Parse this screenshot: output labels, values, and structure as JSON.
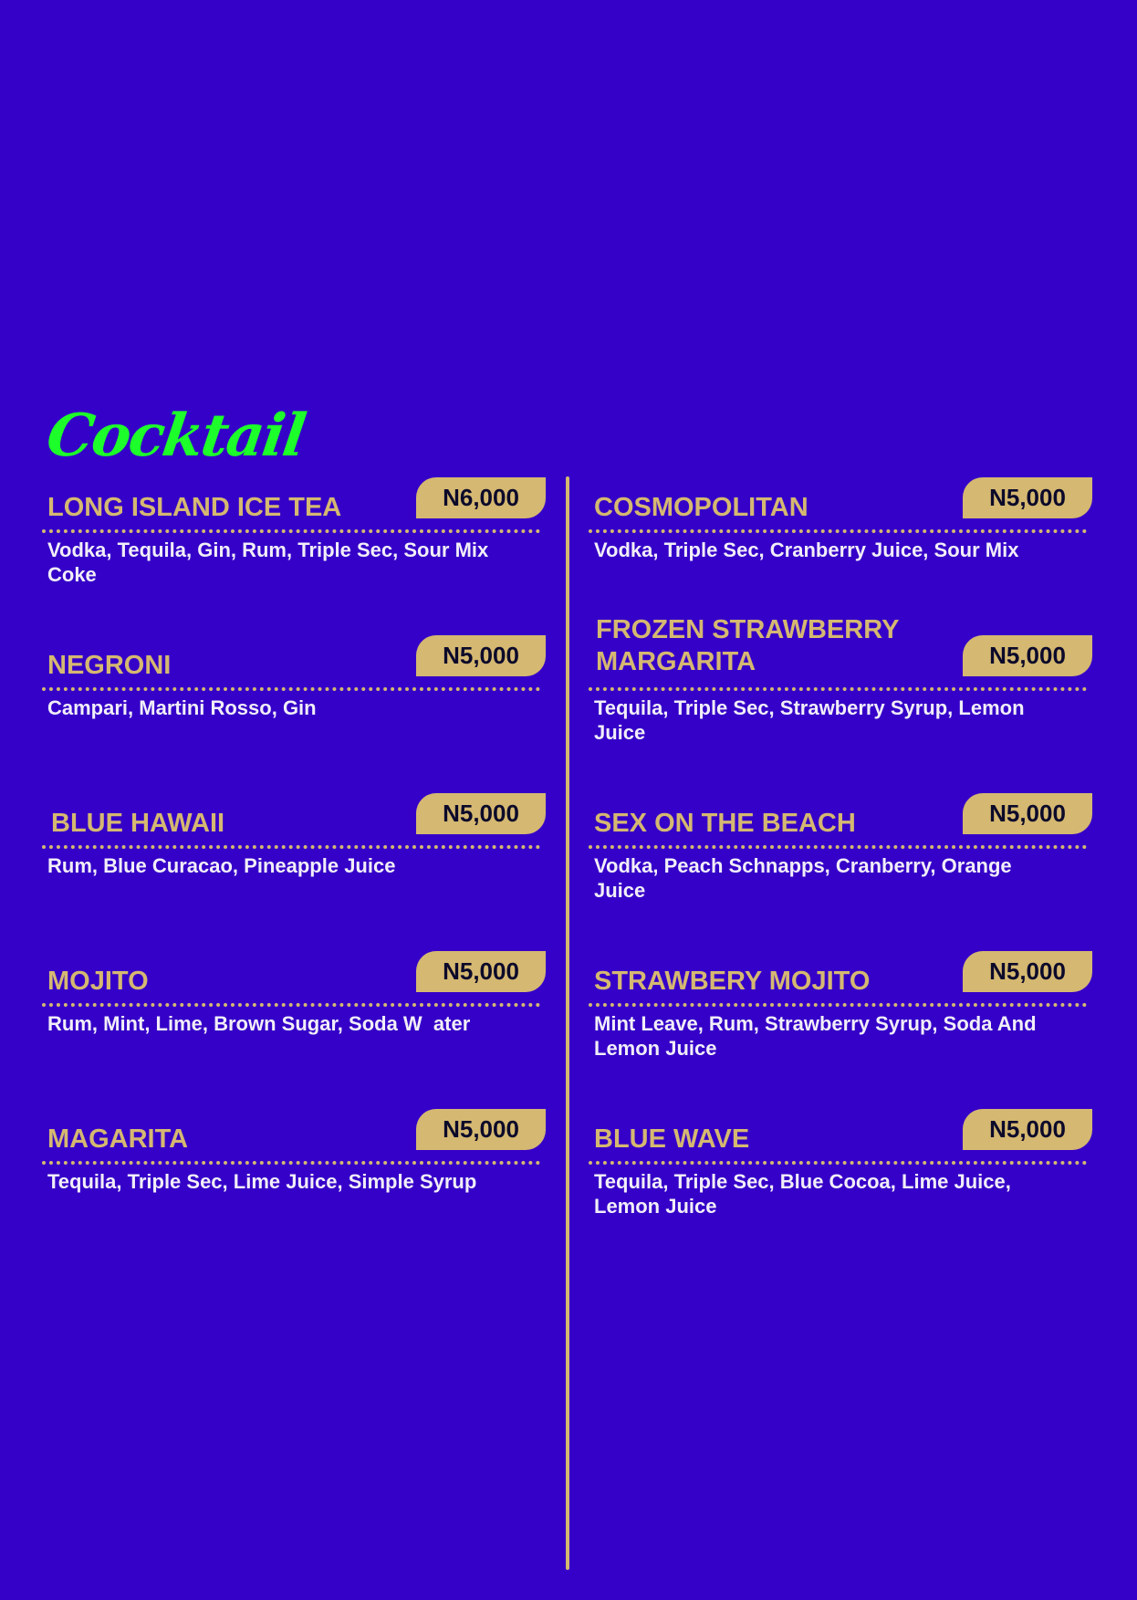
{
  "section_title": "Cocktail",
  "colors": {
    "background": "#3500c8",
    "accent_gold": "#d5b871",
    "title_green": "#1cff2a",
    "text_white": "#f1eef8"
  },
  "items": [
    {
      "name": "LONG ISLAND ICE TEA",
      "price": "N6,000",
      "description": "Vodka, Tequila, Gin, Rum, Triple Sec, Sour Mix Coke"
    },
    {
      "name": "NEGRONI",
      "price": "N5,000",
      "description": "Campari, Martini Rosso, Gin"
    },
    {
      "name": "BLUE HAWAII",
      "price": "N5,000",
      "description": "Rum, Blue Curacao, Pineapple Juice"
    },
    {
      "name": "MOJITO",
      "price": "N5,000",
      "description": "Rum, Mint, Lime, Brown Sugar, Soda W  ater"
    },
    {
      "name": "MAGARITA",
      "price": "N5,000",
      "description": "Tequila, Triple Sec, Lime Juice, Simple Syrup"
    },
    {
      "name": "COSMOPOLITAN",
      "price": "N5,000",
      "description": "Vodka, Triple Sec, Cranberry Juice, Sour Mix"
    },
    {
      "name": "FROZEN STRAWBERRY MARGARITA",
      "price": "N5,000",
      "description": "Tequila, Triple Sec, Strawberry Syrup, Lemon Juice"
    },
    {
      "name": "SEX ON THE BEACH",
      "price": "N5,000",
      "description": "Vodka, Peach Schnapps, Cranberry, Orange Juice"
    },
    {
      "name": "STRAWBERY MOJITO",
      "price": "N5,000",
      "description": "Mint Leave, Rum, Strawberry Syrup, Soda And Lemon Juice"
    },
    {
      "name": "BLUE WAVE",
      "price": "N5,000",
      "description": "Tequila, Triple Sec, Blue Cocoa, Lime Juice, Lemon Juice"
    }
  ]
}
